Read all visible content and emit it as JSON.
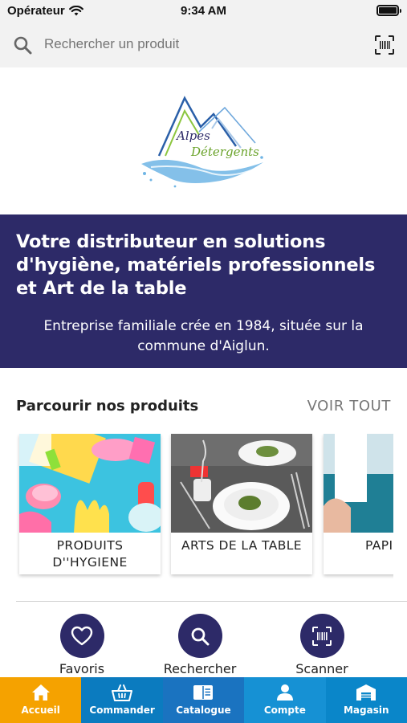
{
  "status_bar": {
    "carrier": "Opérateur",
    "time": "9:34 AM"
  },
  "search": {
    "placeholder": "Rechercher un produit",
    "value": ""
  },
  "logo": {
    "line1": "Alpes",
    "line2": "Détergents"
  },
  "banner": {
    "title": "Votre distributeur en solutions d'hygiène, matériels professionnels et Art de la table",
    "subtitle": "Entreprise familiale crée en 1984, située sur la commune d'Aiglun."
  },
  "browse": {
    "title": "Parcourir nos produits",
    "see_all": "VOIR TOUT",
    "categories": [
      {
        "label": "PRODUITS D''HYGIENE"
      },
      {
        "label": "ARTS DE LA TABLE"
      },
      {
        "label": "PAPIER"
      }
    ]
  },
  "quick_actions": [
    {
      "label": "Favoris",
      "icon": "heart-icon"
    },
    {
      "label": "Rechercher",
      "icon": "search-icon"
    },
    {
      "label": "Scanner",
      "icon": "barcode-scan-icon"
    }
  ],
  "tabs": [
    {
      "label": "Accueil",
      "icon": "home-icon",
      "color": "#f5a200",
      "active": true
    },
    {
      "label": "Commander",
      "icon": "basket-icon",
      "color": "#0b7bbf"
    },
    {
      "label": "Catalogue",
      "icon": "book-icon",
      "color": "#1a73c0"
    },
    {
      "label": "Compte",
      "icon": "user-icon",
      "color": "#1691d4"
    },
    {
      "label": "Magasin",
      "icon": "store-icon",
      "color": "#0a86c9"
    }
  ],
  "colors": {
    "brand_navy": "#2d2a68",
    "accent_orange": "#f5a200",
    "logo_blue": "#2a5fa8",
    "logo_green": "#8cc63f"
  }
}
